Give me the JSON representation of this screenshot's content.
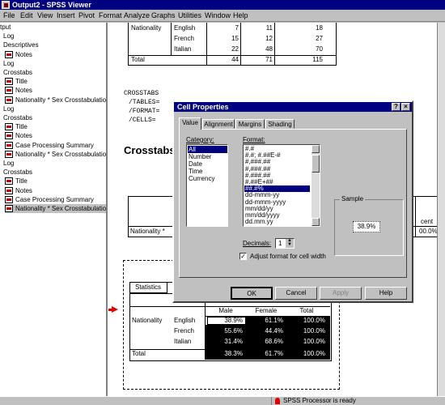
{
  "window": {
    "title": "Output2 - SPSS Viewer"
  },
  "menu": [
    "File",
    "Edit",
    "View",
    "Insert",
    "Pivot",
    "Format",
    "Analyze",
    "Graphs",
    "Utilities",
    "Window",
    "Help"
  ],
  "outline": [
    {
      "label": "tput",
      "indent": 0,
      "icon": false
    },
    {
      "label": "Log",
      "indent": 4,
      "icon": false
    },
    {
      "label": "Descriptives",
      "indent": 4,
      "icon": false
    },
    {
      "label": "Notes",
      "indent": 6,
      "icon": true
    },
    {
      "label": "Log",
      "indent": 4,
      "icon": false
    },
    {
      "label": "Crosstabs",
      "indent": 4,
      "icon": false
    },
    {
      "label": "Title",
      "indent": 6,
      "icon": true
    },
    {
      "label": "Notes",
      "indent": 6,
      "icon": true
    },
    {
      "label": "Nationality * Sex Crosstabulation",
      "indent": 6,
      "icon": true
    },
    {
      "label": "Log",
      "indent": 4,
      "icon": false
    },
    {
      "label": "Crosstabs",
      "indent": 4,
      "icon": false
    },
    {
      "label": "Title",
      "indent": 6,
      "icon": true
    },
    {
      "label": "Notes",
      "indent": 6,
      "icon": true
    },
    {
      "label": "Case Processing Summary",
      "indent": 6,
      "icon": true
    },
    {
      "label": "Nationality * Sex Crosstabulation",
      "indent": 6,
      "icon": true
    },
    {
      "label": "Log",
      "indent": 4,
      "icon": false
    },
    {
      "label": "Crosstabs",
      "indent": 4,
      "icon": false
    },
    {
      "label": "Title",
      "indent": 6,
      "icon": true
    },
    {
      "label": "Notes",
      "indent": 6,
      "icon": true
    },
    {
      "label": "Case Processing Summary",
      "indent": 6,
      "icon": true
    },
    {
      "label": "Nationality * Sex Crosstabulation",
      "indent": 6,
      "icon": true,
      "selected": true
    }
  ],
  "top_table": {
    "row_header": "Nationality",
    "rows": [
      {
        "label": "English",
        "v1": "7",
        "v2": "11",
        "v3": "18"
      },
      {
        "label": "French",
        "v1": "15",
        "v2": "12",
        "v3": "27"
      },
      {
        "label": "Italian",
        "v1": "22",
        "v2": "48",
        "v3": "70"
      }
    ],
    "total": {
      "label": "Total",
      "v1": "44",
      "v2": "71",
      "v3": "115"
    }
  },
  "syntax": [
    "CROSSTABS",
    "/TABLES=",
    "/FORMAT=",
    "/CELLS= "
  ],
  "heading": "Crosstabs",
  "mid_table": {
    "row_label": "Nationality *",
    "col_label": "cent",
    "value": "00.0%"
  },
  "bottom_table": {
    "title": "Statistics",
    "headers": [
      "Male",
      "Female",
      "Total"
    ],
    "row_header": "Nationality",
    "rows": [
      {
        "label": "English",
        "values": [
          "38.9%",
          "61.1%",
          "100.0%"
        ]
      },
      {
        "label": "French",
        "values": [
          "55.6%",
          "44.4%",
          "100.0%"
        ]
      },
      {
        "label": "Italian",
        "values": [
          "31.4%",
          "68.6%",
          "100.0%"
        ]
      }
    ],
    "total": {
      "label": "Total",
      "values": [
        "38.3%",
        "61.7%",
        "100.0%"
      ]
    }
  },
  "dialog": {
    "title": "Cell Properties",
    "help_glyph": "?",
    "close_glyph": "×",
    "tabs": [
      "Value",
      "Alignment",
      "Margins",
      "Shading"
    ],
    "category_label": "Category:",
    "categories": [
      "All",
      "Number",
      "Date",
      "Time",
      "Currency"
    ],
    "format_label": "Format:",
    "formats": [
      "#.#",
      "#.#; #.##E-#",
      "#,###.##",
      "#,###.##",
      "#.###.##",
      "#.##E+##",
      "##.#%",
      "dd-mmm-yy",
      "dd-mmm-yyyy",
      "mm/dd/yy",
      "mm/dd/yyyy",
      "dd.mm.yy"
    ],
    "selected_format_index": 6,
    "sample_label": "Sample",
    "sample_value": "38.9%",
    "decimals_label": "Decimals:",
    "decimals_value": "1",
    "adjust_label": "Adjust format for cell width",
    "adjust_checked": true,
    "buttons": {
      "ok": "OK",
      "cancel": "Cancel",
      "apply": "Apply",
      "help": "Help"
    }
  },
  "status": {
    "text": "SPSS Processor  is ready"
  }
}
